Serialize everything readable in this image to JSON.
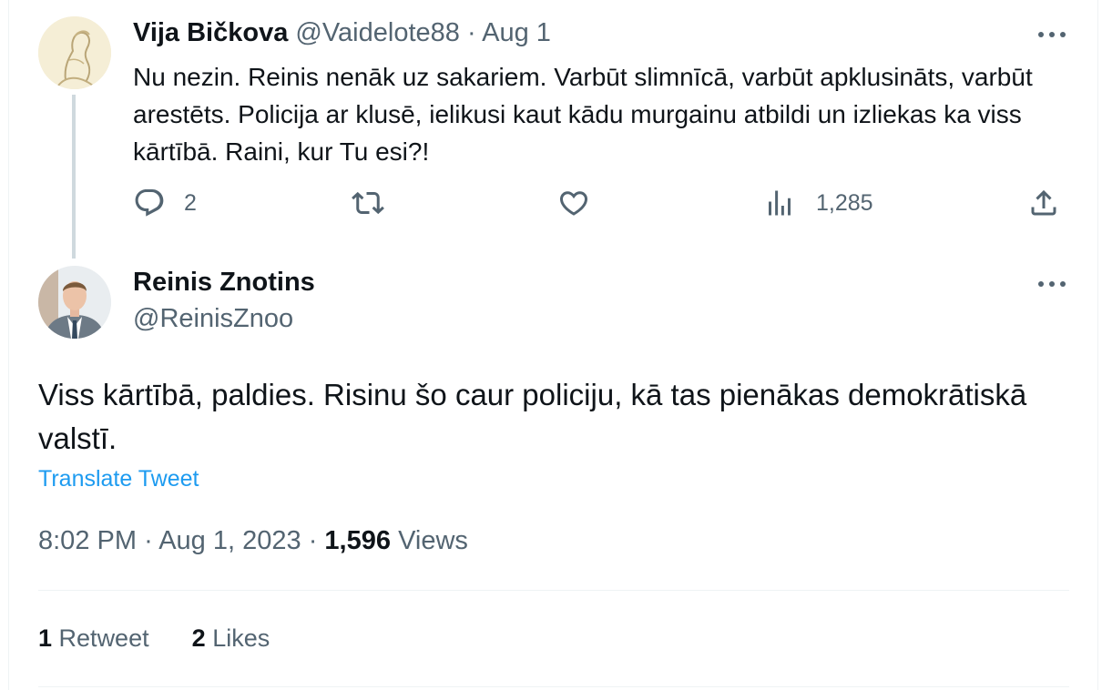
{
  "reply_tweet": {
    "author_name": "Vija Bičkova",
    "author_handle": "@Vaidelote88",
    "separator": "·",
    "date": "Aug 1",
    "text": "Nu nezin. Reinis nenāk uz sakariem. Varbūt slimnīcā, varbūt apklusināts, varbūt arestēts. Policija ar klusē, ielikusi kaut kādu murgainu atbildi un izliekas ka viss kārtībā. Raini, kur Tu esi?!",
    "actions": {
      "reply_count": "2",
      "retweet_count": "",
      "like_count": "",
      "views_count": "1,285"
    },
    "icons": [
      "reply-icon",
      "retweet-icon",
      "like-icon",
      "views-icon",
      "share-icon",
      "more-icon"
    ]
  },
  "main_tweet": {
    "author_name": "Reinis Znotins",
    "author_handle": "@ReinisZnoo",
    "text": "Viss kārtībā, paldies. Risinu šo caur policiju, kā tas pienākas demokrātiskā valstī.",
    "translate_label": "Translate Tweet",
    "time": "8:02 PM",
    "separator": "·",
    "date": "Aug 1, 2023",
    "views_count": "1,596",
    "views_label": "Views",
    "retweets_count": "1",
    "retweets_label": "Retweet",
    "likes_count": "2",
    "likes_label": "Likes"
  },
  "colors": {
    "text_primary": "#0f1419",
    "text_secondary": "#536471",
    "link": "#1d9bf0",
    "divider": "#eff3f4",
    "thread_line": "#cfd9de"
  }
}
